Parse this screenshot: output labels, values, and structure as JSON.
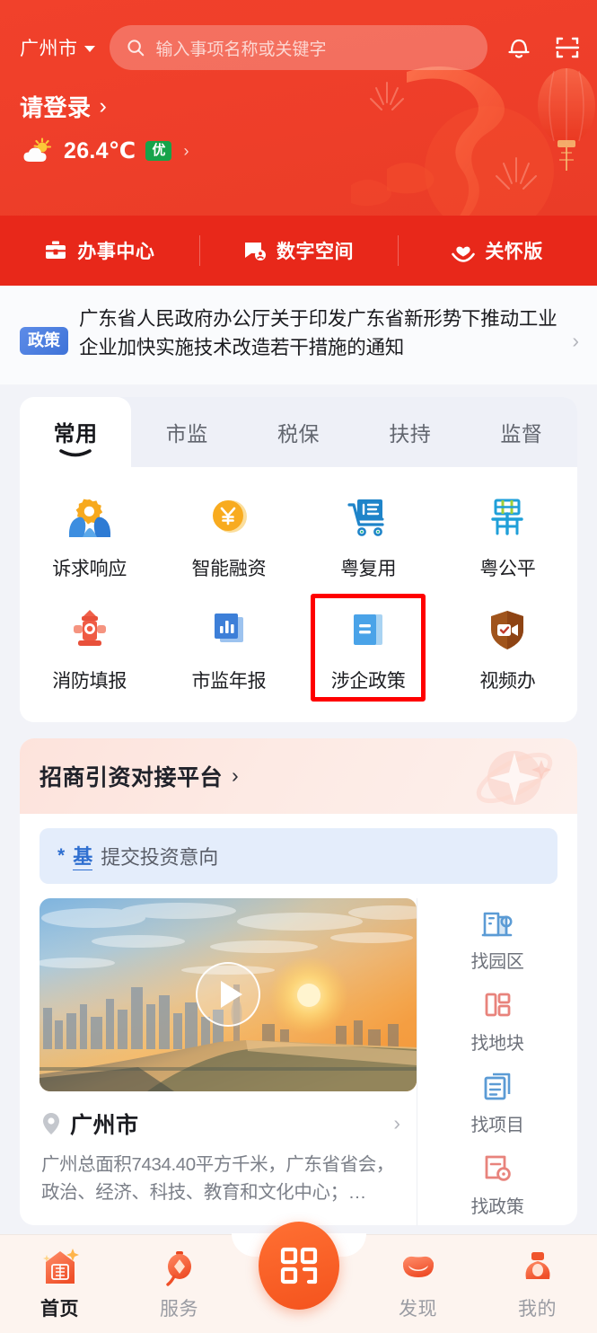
{
  "header": {
    "city": "广州市",
    "city_caret_icon": "chevron-down-icon",
    "search": {
      "icon": "search-icon",
      "placeholder": "输入事项名称或关键字",
      "value": ""
    },
    "notification_icon": "bell-icon",
    "scan_icon": "scan-code-icon",
    "login_label": "请登录",
    "login_chevron": "›",
    "weather": {
      "icon": "sun-cloud-icon",
      "temperature": "26.4℃",
      "air_quality_badge": "优",
      "badge_color": "#16a34a",
      "chevron": "›"
    },
    "bg_color": "#ef3f2a",
    "decoration": "dragon-lantern-motif"
  },
  "quickbar": {
    "bg_color": "#e8281a",
    "items": [
      {
        "label": "办事中心",
        "icon": "briefcase-icon"
      },
      {
        "label": "数字空间",
        "icon": "chat-square-icon"
      },
      {
        "label": "关怀版",
        "icon": "heart-in-hand-icon"
      }
    ]
  },
  "policy_banner": {
    "badge": "政策",
    "badge_color": "#3f73d8",
    "text": "广东省人民政府办公厅关于印发广东省新形势下推动工业企业加快实施技术改造若干措施的通知",
    "arrow": "›"
  },
  "service_card": {
    "tabs": [
      {
        "label": "常用",
        "active": true
      },
      {
        "label": "市监",
        "active": false
      },
      {
        "label": "税保",
        "active": false
      },
      {
        "label": "扶持",
        "active": false
      },
      {
        "label": "监督",
        "active": false
      }
    ],
    "items": [
      {
        "label": "诉求响应",
        "icon": "gear-in-hands-icon",
        "highlighted": false
      },
      {
        "label": "智能融资",
        "icon": "yuan-coin-icon",
        "highlighted": false
      },
      {
        "label": "粤复用",
        "icon": "shopping-cart-doc-icon",
        "highlighted": false
      },
      {
        "label": "粤公平",
        "icon": "yue-character-icon",
        "highlighted": false
      },
      {
        "label": "消防填报",
        "icon": "fire-hydrant-icon",
        "highlighted": false
      },
      {
        "label": "市监年报",
        "icon": "bar-chart-report-icon",
        "highlighted": false
      },
      {
        "label": "涉企政策",
        "icon": "policy-book-icon",
        "highlighted": true
      },
      {
        "label": "视频办",
        "icon": "shield-video-icon",
        "highlighted": false
      }
    ],
    "highlight_color": "#ff0000"
  },
  "investment_card": {
    "title": "招商引资对接平台",
    "title_chevron": "›",
    "decoration_icon": "sparkle-icon",
    "intent_button": {
      "star": "*",
      "tag": "基",
      "label": "提交投资意向"
    },
    "video": {
      "play_icon": "play-button-icon",
      "thumbnail": "guangzhou-sunset-skyline"
    },
    "city": {
      "pin_icon": "location-pin-icon",
      "name": "广州市",
      "chevron": "›",
      "description": "广州总面积7434.40平方千米，广东省省会，政治、经济、科技、教育和文化中心；…"
    },
    "side_links": [
      {
        "label": "找园区",
        "icon": "building-search-icon",
        "color": "#5b9bd5"
      },
      {
        "label": "找地块",
        "icon": "land-parcel-icon",
        "color": "#e8837c"
      },
      {
        "label": "找项目",
        "icon": "project-doc-icon",
        "color": "#5b9bd5"
      },
      {
        "label": "找政策",
        "icon": "policy-search-icon",
        "color": "#e8837c"
      }
    ]
  },
  "tabbar": {
    "bg_color": "#fdf4ef",
    "items": [
      {
        "label": "首页",
        "icon": "home-lantern-icon",
        "active": true
      },
      {
        "label": "服务",
        "icon": "lantern-service-icon",
        "active": false
      },
      {
        "label": "",
        "icon": "qr-grid-icon",
        "active": false,
        "is_fab": true
      },
      {
        "label": "发现",
        "icon": "gold-ingot-discover-icon",
        "active": false
      },
      {
        "label": "我的",
        "icon": "profile-figure-icon",
        "active": false
      }
    ]
  }
}
